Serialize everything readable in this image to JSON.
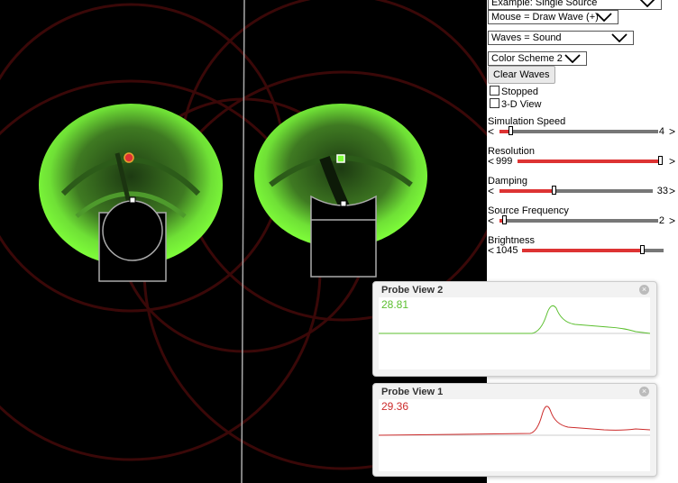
{
  "controls": {
    "example_select": "Example: Single Source",
    "mouse_select": "Mouse = Draw Wave (+)",
    "waves_select": "Waves = Sound",
    "color_scheme_select": "Color Scheme 2",
    "clear_waves_button": "Clear Waves",
    "stopped_checkbox": {
      "label": "Stopped",
      "checked": false
    },
    "view3d_checkbox": {
      "label": "3-D View",
      "checked": false
    }
  },
  "sliders": [
    {
      "label": "Simulation Speed",
      "value_text": "4",
      "fraction": 0.07
    },
    {
      "label": "Resolution",
      "value_text": "999",
      "fraction": 0.99
    },
    {
      "label": "Damping",
      "value_text": "33",
      "fraction": 0.35
    },
    {
      "label": "Source Frequency",
      "value_text": "2",
      "fraction": 0.03
    },
    {
      "label": "Brightness",
      "value_text": "1045",
      "fraction": 0.85
    }
  ],
  "probes": [
    {
      "title": "Probe View 2",
      "value": "28.81",
      "color": "#5bbf2e"
    },
    {
      "title": "Probe View 1",
      "value": "29.36",
      "color": "#cc2b2b"
    }
  ],
  "close_glyph": "×",
  "colors": {
    "wave": "#7fff3a",
    "accent": "#d33333",
    "background": "#000000"
  },
  "icons": [
    "chevron-down-icon",
    "close-icon",
    "source-point-icon"
  ]
}
